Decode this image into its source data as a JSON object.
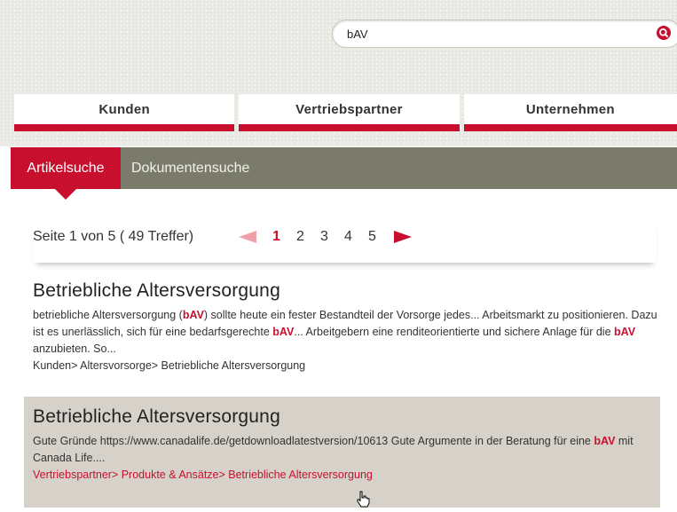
{
  "search": {
    "value": "bAV"
  },
  "nav": {
    "tabs": [
      "Kunden",
      "Vertriebspartner",
      "Unternehmen"
    ]
  },
  "subnav": {
    "tabs": [
      "Artikelsuche",
      "Dokumentensuche"
    ],
    "active": "Artikelsuche"
  },
  "pager": {
    "text": "Seite 1 von 5 ( 49 Treffer)",
    "pages": [
      "1",
      "2",
      "3",
      "4",
      "5"
    ],
    "current": "1"
  },
  "results": [
    {
      "title": "Betriebliche Altersversorgung",
      "snippet": {
        "p1": "betriebliche Altersversorgung (",
        "k1": "bAV",
        "p2": ") sollte heute ein fester Bestandteil der Vorsorge jedes... Arbeitsmarkt zu positionieren. Dazu ist es unerlässlich, sich für eine bedarfsgerechte ",
        "k2": "bAV",
        "p3": "... Arbeitgebern eine renditeorientierte und sichere Anlage für die ",
        "k3": "bAV",
        "p4": " anzubieten. So..."
      },
      "breadcrumb": "Kunden> Altersvorsorge> Betriebliche Altersversorgung"
    },
    {
      "title": "Betriebliche Altersversorgung",
      "snippet": {
        "p1": "Gute Gründe https://www.canadalife.de/getdownloadlatestversion/10613 Gute Argumente in der Beratung für eine ",
        "k1": "bAV",
        "p2": " mit Canada Life...."
      },
      "breadcrumb": "Vertriebspartner> Produkte & Ansätze> Betriebliche Altersversorgung"
    }
  ],
  "colors": {
    "accent": "#c8102e",
    "subnav": "#7b7b6c",
    "highlight_row": "#d6d2ca"
  },
  "icons": {
    "search": "search-icon",
    "prev": "arrow-left-icon",
    "next": "arrow-right-icon",
    "cursor": "hand-cursor-icon"
  }
}
